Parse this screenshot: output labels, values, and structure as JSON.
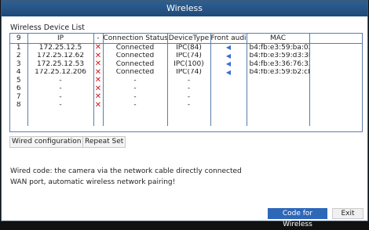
{
  "window": {
    "title": "Wireless"
  },
  "list": {
    "label": "Wireless Device List",
    "headers": [
      "9",
      "IP",
      "-",
      "Connection Status",
      "DeviceType",
      "Front audio",
      "MAC",
      ""
    ],
    "rows": [
      {
        "idx": "1",
        "ip": "172.25.12.5",
        "status": "Connected",
        "type": "IPC(84)",
        "audio": true,
        "mac": "b4:fb:e3:59:ba:02"
      },
      {
        "idx": "2",
        "ip": "172.25.12.62",
        "status": "Connected",
        "type": "IPC(74)",
        "audio": true,
        "mac": "b4:fb:e3:59:d3:3b"
      },
      {
        "idx": "3",
        "ip": "172.25.12.53",
        "status": "Connected",
        "type": "IPC(100)",
        "audio": true,
        "mac": "b4:fb:e3:36:76:32"
      },
      {
        "idx": "4",
        "ip": "172.25.12.206",
        "status": "Connected",
        "type": "IPC(74)",
        "audio": true,
        "mac": "b4:fb:e3:59:b2:cb"
      },
      {
        "idx": "5",
        "ip": "-",
        "status": "-",
        "type": "-",
        "audio": false,
        "mac": ""
      },
      {
        "idx": "6",
        "ip": "-",
        "status": "-",
        "type": "-",
        "audio": false,
        "mac": ""
      },
      {
        "idx": "7",
        "ip": "-",
        "status": "-",
        "type": "-",
        "audio": false,
        "mac": ""
      },
      {
        "idx": "8",
        "ip": "-",
        "status": "-",
        "type": "-",
        "audio": false,
        "mac": ""
      }
    ]
  },
  "buttons": {
    "wired_config": "Wired configuration",
    "repeat_set": "Repeat Set",
    "code_for_wireless": "Code for Wireless",
    "exit": "Exit"
  },
  "description": "Wired code: the camera via the network cable directly connected WAN port, automatic wireless network pairing!",
  "icons": {
    "delete": "delete-x-icon",
    "audio": "speaker-icon"
  },
  "colors": {
    "title_bar": "#2a5a8c",
    "accent": "#2e67b8",
    "delete": "#d01818",
    "audio": "#3a6fd0"
  }
}
